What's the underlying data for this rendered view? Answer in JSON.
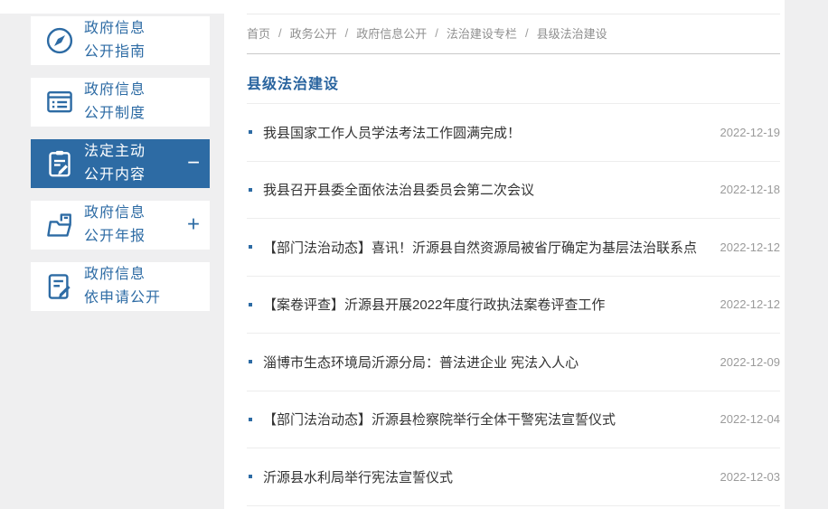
{
  "colors": {
    "accent_blue": "#2d6ba4",
    "title_blue": "#28639e",
    "page_background": "#efeff0",
    "panel_background": "#ffffff",
    "text_dark": "#333333",
    "text_gray": "#8f8f8f"
  },
  "sidebar": {
    "items": [
      {
        "icon": "compass-icon",
        "line1": "政府信息",
        "line2": "公开指南",
        "active": false,
        "toggle": ""
      },
      {
        "icon": "document-lines-icon",
        "line1": "政府信息",
        "line2": "公开制度",
        "active": false,
        "toggle": ""
      },
      {
        "icon": "clipboard-pen-icon",
        "line1": "法定主动",
        "line2": "公开内容",
        "active": true,
        "toggle": "−"
      },
      {
        "icon": "folder-doc-icon",
        "line1": "政府信息",
        "line2": "公开年报",
        "active": false,
        "toggle": "+"
      },
      {
        "icon": "doc-pen-icon",
        "line1": "政府信息",
        "line2": "依申请公开",
        "active": false,
        "toggle": ""
      }
    ]
  },
  "breadcrumb": {
    "separator": "/",
    "items": [
      "首页",
      "政务公开",
      "政府信息公开",
      "法治建设专栏",
      "县级法治建设"
    ]
  },
  "page": {
    "title": "县级法治建设"
  },
  "news": {
    "items": [
      {
        "title": "我县国家工作人员学法考法工作圆满完成！",
        "date": "2022-12-19"
      },
      {
        "title": "我县召开县委全面依法治县委员会第二次会议",
        "date": "2022-12-18"
      },
      {
        "title": "【部门法治动态】喜讯！沂源县自然资源局被省厅确定为基层法治联系点",
        "date": "2022-12-12"
      },
      {
        "title": "【案卷评查】沂源县开展2022年度行政执法案卷评查工作",
        "date": "2022-12-12"
      },
      {
        "title": "淄博市生态环境局沂源分局：普法进企业 宪法入人心",
        "date": "2022-12-09"
      },
      {
        "title": "【部门法治动态】沂源县检察院举行全体干警宪法宣誓仪式",
        "date": "2022-12-04"
      },
      {
        "title": "沂源县水利局举行宪法宣誓仪式",
        "date": "2022-12-03"
      }
    ]
  }
}
